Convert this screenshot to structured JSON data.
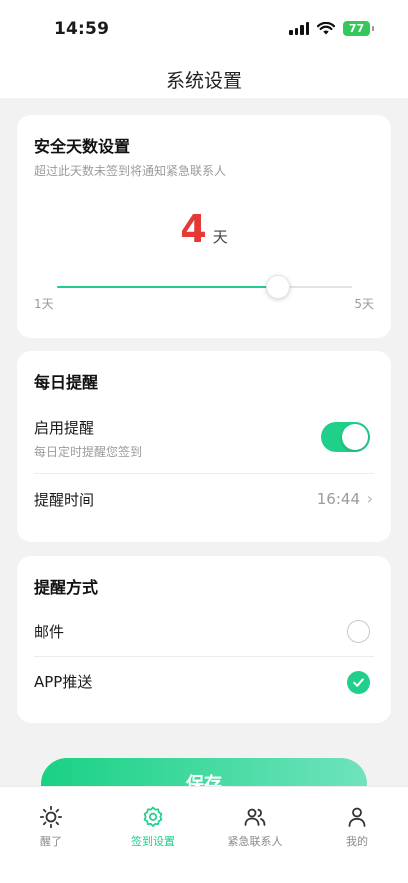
{
  "status_bar": {
    "time": "14:59",
    "battery": "77"
  },
  "header": {
    "title": "系统设置"
  },
  "safe_days": {
    "title": "安全天数设置",
    "subtitle": "超过此天数未签到将通知紧急联系人",
    "value": "4",
    "unit": "天",
    "min_label": "1天",
    "max_label": "5天",
    "slider": {
      "min": 1,
      "max": 5,
      "value": 4
    }
  },
  "daily_reminder": {
    "title": "每日提醒",
    "enable_label": "启用提醒",
    "enable_sub": "每日定时提醒您签到",
    "enabled": true,
    "time_label": "提醒时间",
    "time_value": "16:44"
  },
  "reminder_method": {
    "title": "提醒方式",
    "options": [
      {
        "label": "邮件",
        "checked": false
      },
      {
        "label": "APP推送",
        "checked": true
      }
    ]
  },
  "save_button": {
    "label": "保存"
  },
  "tabbar": {
    "items": [
      {
        "label": "醒了",
        "icon": "sun-icon",
        "active": false
      },
      {
        "label": "签到设置",
        "icon": "gear-icon",
        "active": true
      },
      {
        "label": "紧急联系人",
        "icon": "contacts-icon",
        "active": false
      },
      {
        "label": "我的",
        "icon": "person-icon",
        "active": false
      }
    ]
  },
  "colors": {
    "accent": "#1fcf8a",
    "days_value": "#e53935",
    "background": "#f2f2f2"
  }
}
